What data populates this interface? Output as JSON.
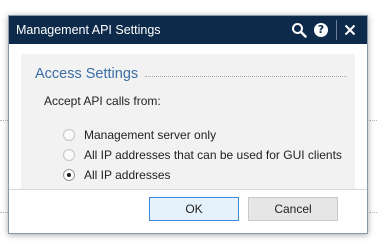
{
  "window": {
    "title": "Management API Settings",
    "titlebar_color": "#0d2a4a",
    "icons": [
      "search-icon",
      "help-icon",
      "close-icon"
    ]
  },
  "section": {
    "title": "Access Settings",
    "title_color": "#3a6ea5"
  },
  "prompt": "Accept API calls from:",
  "options": [
    {
      "label": "Management server only",
      "selected": false
    },
    {
      "label": "All IP addresses that can be used for GUI clients",
      "selected": false
    },
    {
      "label": "All IP addresses",
      "selected": true
    }
  ],
  "buttons": {
    "ok": "OK",
    "cancel": "Cancel"
  }
}
